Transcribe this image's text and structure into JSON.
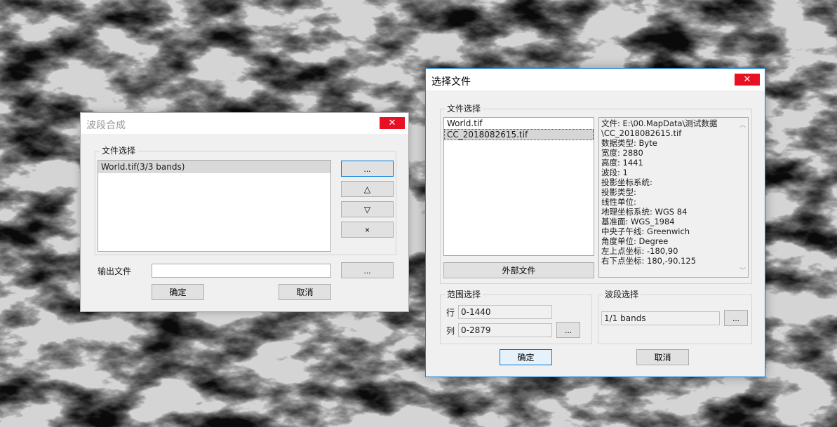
{
  "band_composite": {
    "title": "波段合成",
    "close_glyph": "✕",
    "file_group_label": "文件选择",
    "files": [
      "World.tif(3/3 bands)"
    ],
    "browse_label": "...",
    "up_label": "△",
    "down_label": "▽",
    "remove_label": "×",
    "output_label": "输出文件",
    "output_value": "",
    "output_browse_label": "...",
    "ok_label": "确定",
    "cancel_label": "取消"
  },
  "select_file": {
    "title": "选择文件",
    "close_glyph": "✕",
    "file_group_label": "文件选择",
    "files": [
      "World.tif",
      "CC_2018082615.tif"
    ],
    "external_file_label": "外部文件",
    "info_lines": [
      "文件:  E:\\00.MapData\\测试数据",
      "\\CC_2018082615.tif",
      "数据类型:  Byte",
      "宽度:  2880",
      "高度:  1441",
      "波段:  1",
      "投影坐标系统:",
      "投影类型:",
      "线性单位:",
      "地理坐标系统:  WGS 84",
      "基准面:  WGS_1984",
      "中央子午线:  Greenwich",
      "角度单位:  Degree",
      "左上点坐标:  -180,90",
      "右下点坐标:  180,-90.125"
    ],
    "range_group_label": "范围选择",
    "row_label": "行",
    "row_value": "0-1440",
    "col_label": "列",
    "col_value": "0-2879",
    "range_btn_label": "...",
    "band_group_label": "波段选择",
    "band_value": "1/1  bands",
    "band_btn_label": "...",
    "ok_label": "确定",
    "cancel_label": "取消"
  }
}
